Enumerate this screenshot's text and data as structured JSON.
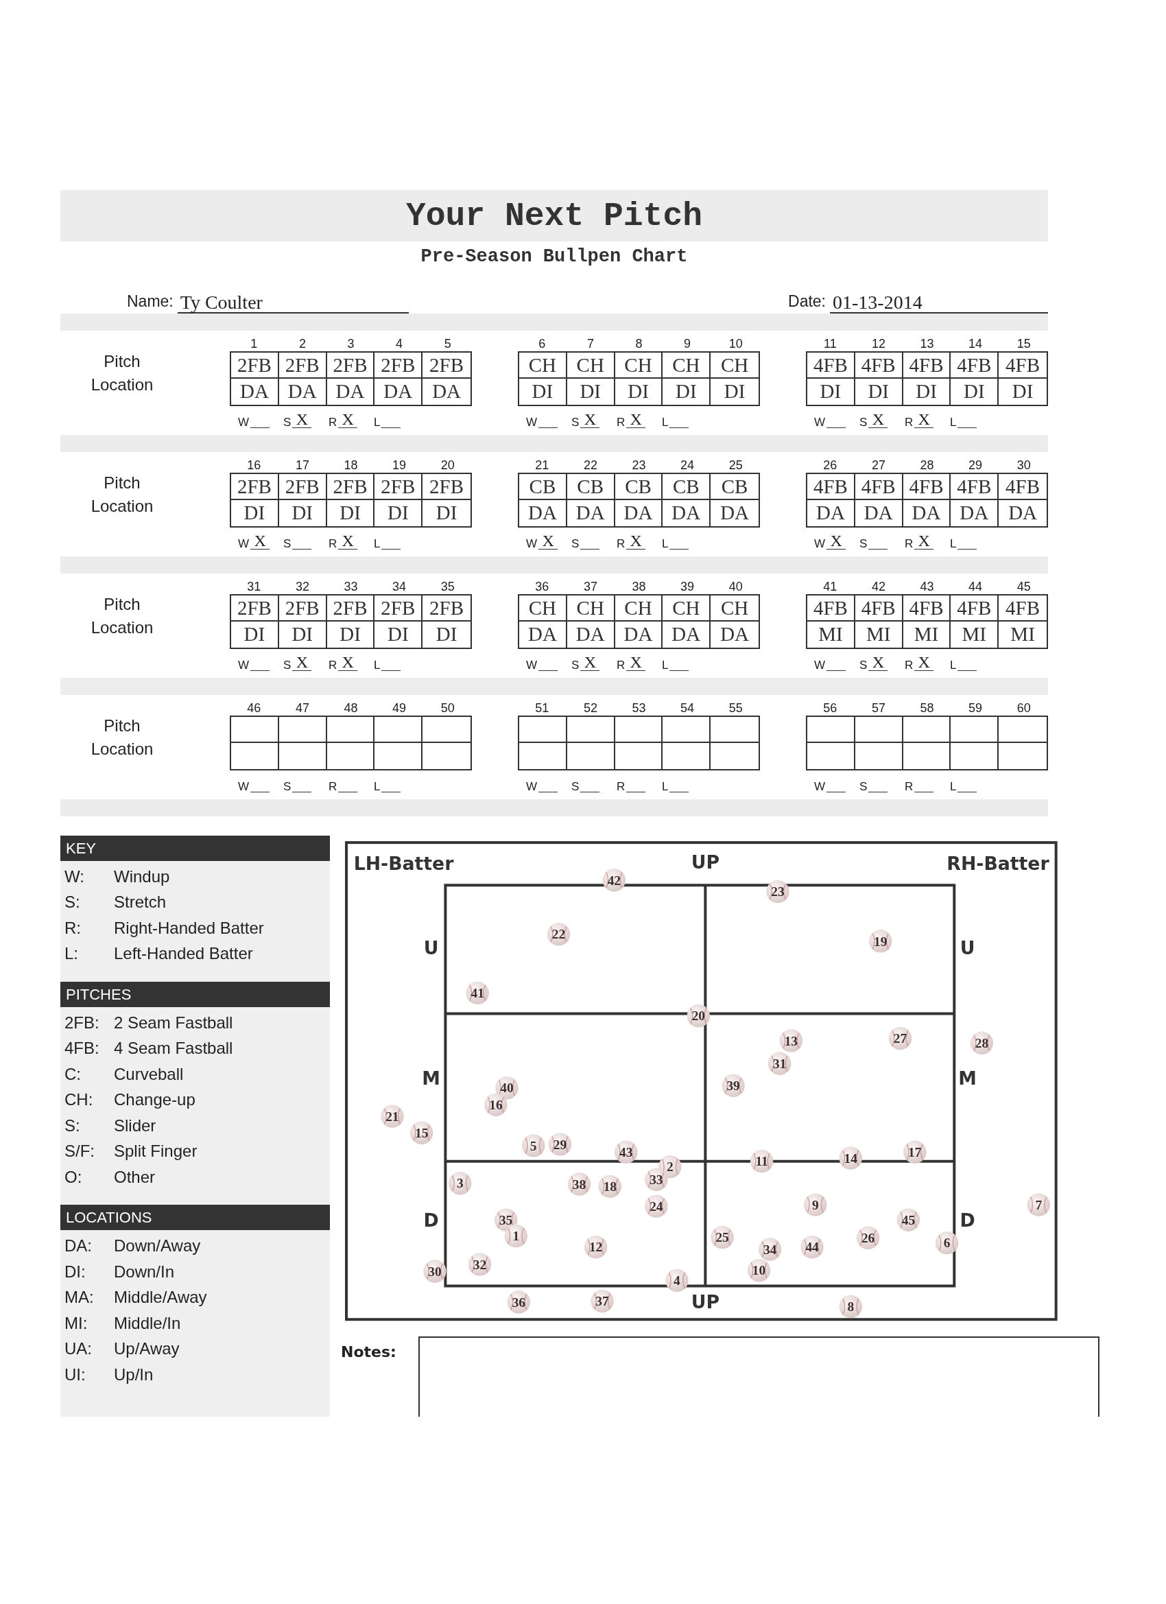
{
  "header": {
    "title": "Your Next Pitch",
    "subtitle": "Pre-Season Bullpen Chart"
  },
  "name_field": {
    "label": "Name:",
    "value": "Ty Coulter"
  },
  "date_field": {
    "label": "Date:",
    "value": "01-13-2014"
  },
  "set_rows": [
    {
      "labels": [
        "Pitch",
        "Location"
      ],
      "sets": [
        {
          "cells": [
            {
              "number": "1",
              "pitch": "2FB",
              "location": "DA"
            },
            {
              "number": "2",
              "pitch": "2FB",
              "location": "DA"
            },
            {
              "number": "3",
              "pitch": "2FB",
              "location": "DA"
            },
            {
              "number": "4",
              "pitch": "2FB",
              "location": "DA"
            },
            {
              "number": "5",
              "pitch": "2FB",
              "location": "DA"
            }
          ],
          "marks": [
            {
              "label": "W"
            },
            {
              "label": "S",
              "value": "X"
            },
            {
              "label": "R",
              "value": "X"
            },
            {
              "label": "L"
            }
          ]
        },
        {
          "cells": [
            {
              "number": "6",
              "pitch": "CH",
              "location": "DI"
            },
            {
              "number": "7",
              "pitch": "CH",
              "location": "DI"
            },
            {
              "number": "8",
              "pitch": "CH",
              "location": "DI"
            },
            {
              "number": "9",
              "pitch": "CH",
              "location": "DI"
            },
            {
              "number": "10",
              "pitch": "CH",
              "location": "DI"
            }
          ],
          "marks": [
            {
              "label": "W"
            },
            {
              "label": "S",
              "value": "X"
            },
            {
              "label": "R",
              "value": "X"
            },
            {
              "label": "L"
            }
          ]
        },
        {
          "cells": [
            {
              "number": "11",
              "pitch": "4FB",
              "location": "DI"
            },
            {
              "number": "12",
              "pitch": "4FB",
              "location": "DI"
            },
            {
              "number": "13",
              "pitch": "4FB",
              "location": "DI"
            },
            {
              "number": "14",
              "pitch": "4FB",
              "location": "DI"
            },
            {
              "number": "15",
              "pitch": "4FB",
              "location": "DI"
            }
          ],
          "marks": [
            {
              "label": "W"
            },
            {
              "label": "S",
              "value": "X"
            },
            {
              "label": "R",
              "value": "X"
            },
            {
              "label": "L"
            }
          ]
        }
      ]
    },
    {
      "labels": [
        "Pitch",
        "Location"
      ],
      "sets": [
        {
          "cells": [
            {
              "number": "16",
              "pitch": "2FB",
              "location": "DI"
            },
            {
              "number": "17",
              "pitch": "2FB",
              "location": "DI"
            },
            {
              "number": "18",
              "pitch": "2FB",
              "location": "DI"
            },
            {
              "number": "19",
              "pitch": "2FB",
              "location": "DI"
            },
            {
              "number": "20",
              "pitch": "2FB",
              "location": "DI"
            }
          ],
          "marks": [
            {
              "label": "W",
              "value": "X"
            },
            {
              "label": "S"
            },
            {
              "label": "R",
              "value": "X"
            },
            {
              "label": "L"
            }
          ]
        },
        {
          "cells": [
            {
              "number": "21",
              "pitch": "CB",
              "location": "DA"
            },
            {
              "number": "22",
              "pitch": "CB",
              "location": "DA"
            },
            {
              "number": "23",
              "pitch": "CB",
              "location": "DA"
            },
            {
              "number": "24",
              "pitch": "CB",
              "location": "DA"
            },
            {
              "number": "25",
              "pitch": "CB",
              "location": "DA"
            }
          ],
          "marks": [
            {
              "label": "W",
              "value": "X"
            },
            {
              "label": "S"
            },
            {
              "label": "R",
              "value": "X"
            },
            {
              "label": "L"
            }
          ]
        },
        {
          "cells": [
            {
              "number": "26",
              "pitch": "4FB",
              "location": "DA"
            },
            {
              "number": "27",
              "pitch": "4FB",
              "location": "DA"
            },
            {
              "number": "28",
              "pitch": "4FB",
              "location": "DA"
            },
            {
              "number": "29",
              "pitch": "4FB",
              "location": "DA"
            },
            {
              "number": "30",
              "pitch": "4FB",
              "location": "DA"
            }
          ],
          "marks": [
            {
              "label": "W",
              "value": "X"
            },
            {
              "label": "S"
            },
            {
              "label": "R",
              "value": "X"
            },
            {
              "label": "L"
            }
          ]
        }
      ]
    },
    {
      "labels": [
        "Pitch",
        "Location"
      ],
      "sets": [
        {
          "cells": [
            {
              "number": "31",
              "pitch": "2FB",
              "location": "DI"
            },
            {
              "number": "32",
              "pitch": "2FB",
              "location": "DI"
            },
            {
              "number": "33",
              "pitch": "2FB",
              "location": "DI"
            },
            {
              "number": "34",
              "pitch": "2FB",
              "location": "DI"
            },
            {
              "number": "35",
              "pitch": "2FB",
              "location": "DI"
            }
          ],
          "marks": [
            {
              "label": "W"
            },
            {
              "label": "S",
              "value": "X"
            },
            {
              "label": "R",
              "value": "X"
            },
            {
              "label": "L"
            }
          ]
        },
        {
          "cells": [
            {
              "number": "36",
              "pitch": "CH",
              "location": "DA"
            },
            {
              "number": "37",
              "pitch": "CH",
              "location": "DA"
            },
            {
              "number": "38",
              "pitch": "CH",
              "location": "DA"
            },
            {
              "number": "39",
              "pitch": "CH",
              "location": "DA"
            },
            {
              "number": "40",
              "pitch": "CH",
              "location": "DA"
            }
          ],
          "marks": [
            {
              "label": "W"
            },
            {
              "label": "S",
              "value": "X"
            },
            {
              "label": "R",
              "value": "X"
            },
            {
              "label": "L"
            }
          ]
        },
        {
          "cells": [
            {
              "number": "41",
              "pitch": "4FB",
              "location": "MI"
            },
            {
              "number": "42",
              "pitch": "4FB",
              "location": "MI"
            },
            {
              "number": "43",
              "pitch": "4FB",
              "location": "MI"
            },
            {
              "number": "44",
              "pitch": "4FB",
              "location": "MI"
            },
            {
              "number": "45",
              "pitch": "4FB",
              "location": "MI"
            }
          ],
          "marks": [
            {
              "label": "W"
            },
            {
              "label": "S",
              "value": "X"
            },
            {
              "label": "R",
              "value": "X"
            },
            {
              "label": "L"
            }
          ]
        }
      ]
    },
    {
      "labels": [
        "Pitch",
        "Location"
      ],
      "sets": [
        {
          "cells": [
            {
              "number": "46"
            },
            {
              "number": "47"
            },
            {
              "number": "48"
            },
            {
              "number": "49"
            },
            {
              "number": "50"
            }
          ],
          "marks": [
            {
              "label": "W"
            },
            {
              "label": "S"
            },
            {
              "label": "R"
            },
            {
              "label": "L"
            }
          ]
        },
        {
          "cells": [
            {
              "number": "51"
            },
            {
              "number": "52"
            },
            {
              "number": "53"
            },
            {
              "number": "54"
            },
            {
              "number": "55"
            }
          ],
          "marks": [
            {
              "label": "W"
            },
            {
              "label": "S"
            },
            {
              "label": "R"
            },
            {
              "label": "L"
            }
          ]
        },
        {
          "cells": [
            {
              "number": "56"
            },
            {
              "number": "57"
            },
            {
              "number": "58"
            },
            {
              "number": "59"
            },
            {
              "number": "60"
            }
          ],
          "marks": [
            {
              "label": "W"
            },
            {
              "label": "S"
            },
            {
              "label": "R"
            },
            {
              "label": "L"
            }
          ]
        }
      ]
    }
  ],
  "key_sections": [
    {
      "title": "KEY",
      "items": [
        {
          "code": "W:",
          "meaning": "Windup"
        },
        {
          "code": "S:",
          "meaning": "Stretch"
        },
        {
          "code": "R:",
          "meaning": "Right-Handed Batter"
        },
        {
          "code": "L:",
          "meaning": "Left-Handed Batter"
        }
      ]
    },
    {
      "title": "PITCHES",
      "items": [
        {
          "code": "2FB:",
          "meaning": "2 Seam Fastball"
        },
        {
          "code": "4FB:",
          "meaning": "4 Seam Fastball"
        },
        {
          "code": "C:",
          "meaning": "Curveball"
        },
        {
          "code": "CH:",
          "meaning": "Change-up"
        },
        {
          "code": "S:",
          "meaning": "Slider"
        },
        {
          "code": "S/F:",
          "meaning": "Split Finger"
        },
        {
          "code": "O:",
          "meaning": "Other"
        }
      ]
    },
    {
      "title": "LOCATIONS",
      "items": [
        {
          "code": "DA:",
          "meaning": "Down/Away"
        },
        {
          "code": "DI:",
          "meaning": "Down/In"
        },
        {
          "code": "MA:",
          "meaning": "Middle/Away"
        },
        {
          "code": "MI:",
          "meaning": "Middle/In"
        },
        {
          "code": "UA:",
          "meaning": "Up/Away"
        },
        {
          "code": "UI:",
          "meaning": "Up/In"
        }
      ]
    }
  ],
  "strike_zone": {
    "left_batter": "LH-Batter",
    "top_label": "UP",
    "right_batter": "RH-Batter",
    "bottom_label": "UP",
    "left_row_labels": [
      "U",
      "M",
      "D"
    ],
    "right_row_labels": [
      "U",
      "M",
      "D"
    ],
    "markers": [
      {
        "label": "42"
      },
      {
        "label": "23"
      },
      {
        "label": "22"
      },
      {
        "label": "19"
      },
      {
        "label": "41"
      },
      {
        "label": "20"
      },
      {
        "label": "13"
      },
      {
        "label": "27"
      },
      {
        "label": "28"
      },
      {
        "label": "31"
      },
      {
        "label": "39"
      },
      {
        "label": "40"
      },
      {
        "label": "16"
      },
      {
        "label": "21"
      },
      {
        "label": "15"
      },
      {
        "label": "5"
      },
      {
        "label": "29"
      },
      {
        "label": "43"
      },
      {
        "label": "2"
      },
      {
        "label": "11"
      },
      {
        "label": "14"
      },
      {
        "label": "17"
      },
      {
        "label": "3"
      },
      {
        "label": "38"
      },
      {
        "label": "18"
      },
      {
        "label": "33"
      },
      {
        "label": "24"
      },
      {
        "label": "9"
      },
      {
        "label": "7"
      },
      {
        "label": "35"
      },
      {
        "label": "45"
      },
      {
        "label": "1"
      },
      {
        "label": "25"
      },
      {
        "label": "26"
      },
      {
        "label": "12"
      },
      {
        "label": "34"
      },
      {
        "label": "44"
      },
      {
        "label": "6"
      },
      {
        "label": "30"
      },
      {
        "label": "32"
      },
      {
        "label": "4"
      },
      {
        "label": "10"
      },
      {
        "label": "36"
      },
      {
        "label": "37"
      },
      {
        "label": "8"
      }
    ]
  },
  "notes": {
    "label": "Notes:"
  }
}
